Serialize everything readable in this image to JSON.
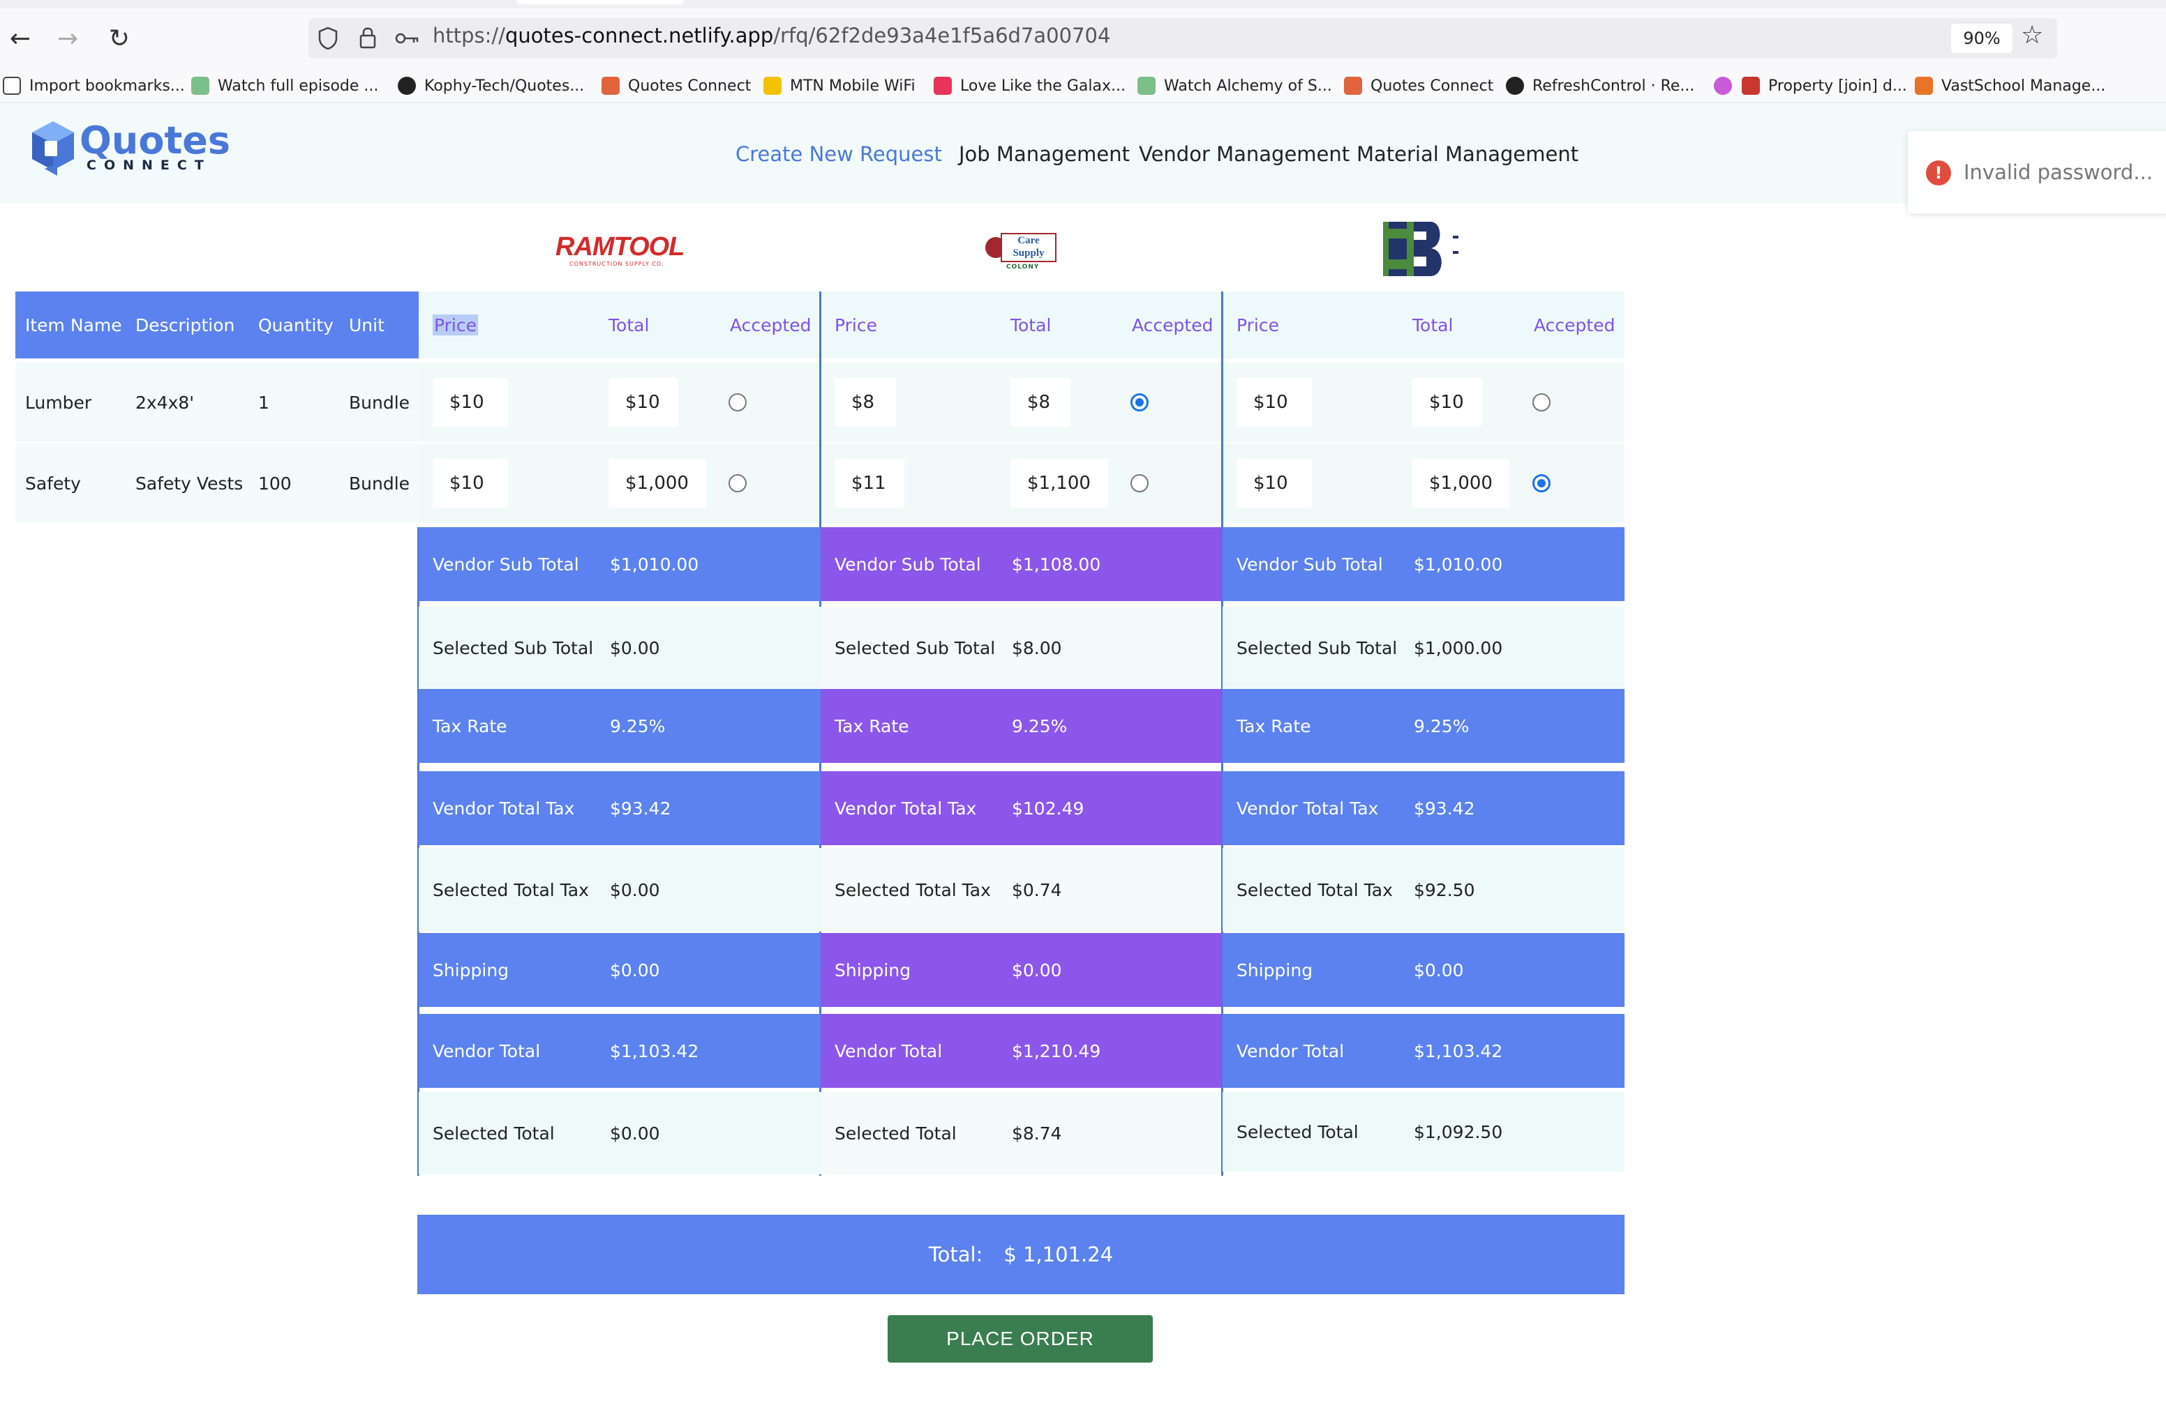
{
  "browser": {
    "url_prefix": "https://",
    "url_host": "quotes-connect.netlify.app",
    "url_path": "/rfq/62f2de93a4e1f5a6d7a00704",
    "zoom": "90%"
  },
  "bookmarks": [
    {
      "label": "Import bookmarks...",
      "color": "#444444"
    },
    {
      "label": "Watch full episode ...",
      "color": "#7bbf8a"
    },
    {
      "label": "Kophy-Tech/Quotes...",
      "color": "#222222"
    },
    {
      "label": "Quotes Connect",
      "color": "#e2643c"
    },
    {
      "label": "MTN Mobile WiFi",
      "color": "#f2c200"
    },
    {
      "label": "Love Like the Galax...",
      "color": "#e8335a"
    },
    {
      "label": "Watch Alchemy of S...",
      "color": "#7bbf8a"
    },
    {
      "label": "Quotes Connect",
      "color": "#e2643c"
    },
    {
      "label": "RefreshControl · Re...",
      "color": "#222222"
    },
    {
      "label": "",
      "color": "#c65ad8"
    },
    {
      "label": "Property [join] d...",
      "color": "#c8382e"
    },
    {
      "label": "VastSchool Manage...",
      "color": "#e8742a"
    }
  ],
  "app": {
    "logo_text": "Quotes",
    "logo_sub": "CONNECT",
    "nav": [
      "Create New Request",
      "Job Management",
      "Vendor Management",
      "Material Management"
    ],
    "toast": "Invalid password..."
  },
  "vendors": [
    {
      "logo": "RAMTOOL",
      "logo_sub": "CONSTRUCTION SUPPLY CO."
    },
    {
      "logo": "Care Supply",
      "logo_sub": "COLONY"
    },
    {
      "logo": "EB",
      "logo_sub": ""
    }
  ],
  "table": {
    "headers": [
      "Item Name",
      "Description",
      "Quantity",
      "Unit"
    ],
    "vendor_headers": [
      "Price",
      "Total",
      "Accepted"
    ],
    "rows": [
      {
        "item": "Lumber",
        "description": "2x4x8'",
        "quantity": "1",
        "unit": "Bundle",
        "vendors": [
          {
            "price": "$10",
            "total": "$10",
            "accepted": false
          },
          {
            "price": "$8",
            "total": "$8",
            "accepted": true
          },
          {
            "price": "$10",
            "total": "$10",
            "accepted": false
          }
        ]
      },
      {
        "item": "Safety",
        "description": "Safety Vests",
        "quantity": "100",
        "unit": "Bundle",
        "vendors": [
          {
            "price": "$10",
            "total": "$1,000",
            "accepted": false
          },
          {
            "price": "$11",
            "total": "$1,100",
            "accepted": false
          },
          {
            "price": "$10",
            "total": "$1,000",
            "accepted": true
          }
        ]
      }
    ]
  },
  "summary_labels": [
    "Vendor Sub Total",
    "Selected Sub Total",
    "Tax Rate",
    "Vendor Total Tax",
    "Selected Total Tax",
    "Shipping",
    "Vendor Total",
    "Selected Total"
  ],
  "summary": [
    [
      "$1,010.00",
      "$0.00",
      "9.25%",
      "$93.42",
      "$0.00",
      "$0.00",
      "$1,103.42",
      "$0.00"
    ],
    [
      "$1,108.00",
      "$8.00",
      "9.25%",
      "$102.49",
      "$0.74",
      "$0.00",
      "$1,210.49",
      "$8.74"
    ],
    [
      "$1,010.00",
      "$1,000.00",
      "9.25%",
      "$93.42",
      "$92.50",
      "$0.00",
      "$1,103.42",
      "$1,092.50"
    ]
  ],
  "total": {
    "label": "Total:",
    "value": "$ 1,101.24"
  },
  "place_order": "PLACE ORDER",
  "colors": {
    "accent_blue": "#5b82ee",
    "accent_purple": "#8c56ea",
    "button_green": "#3a7d4f",
    "link_blue": "#4a78d8"
  }
}
